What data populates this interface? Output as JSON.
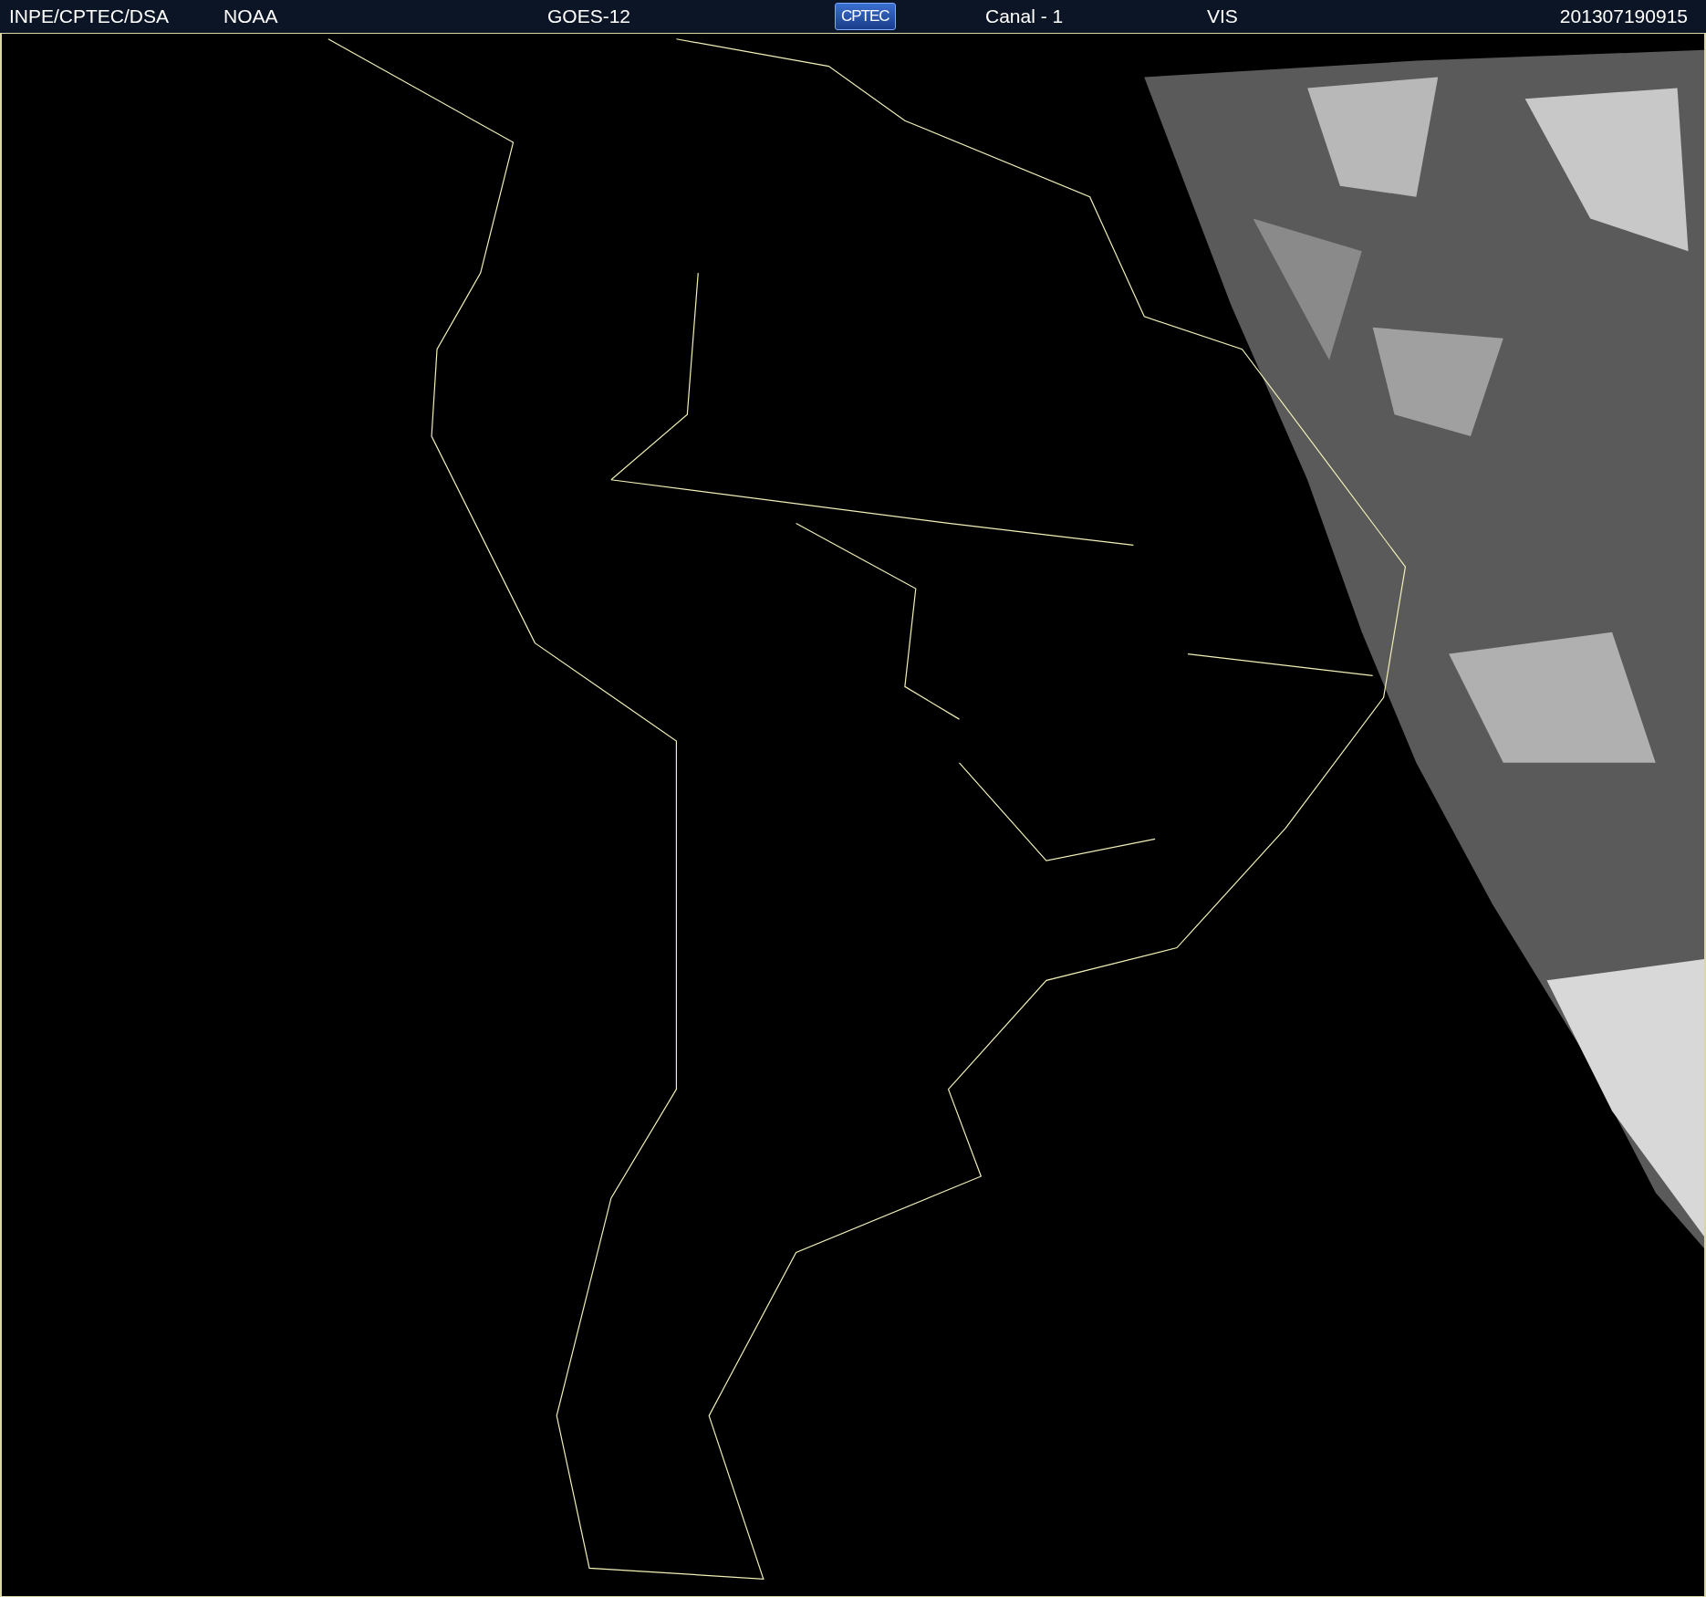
{
  "header": {
    "items": [
      {
        "kind": "text",
        "text": "INPE/CPTEC/DSA"
      },
      {
        "kind": "text",
        "text": "NOAA"
      },
      {
        "kind": "text",
        "text": "GOES-12"
      },
      {
        "kind": "logo",
        "text": "CPTEC"
      },
      {
        "kind": "text",
        "text": "Canal - 1"
      },
      {
        "kind": "text",
        "text": "VIS"
      },
      {
        "kind": "text",
        "text": "201307190915"
      }
    ]
  }
}
